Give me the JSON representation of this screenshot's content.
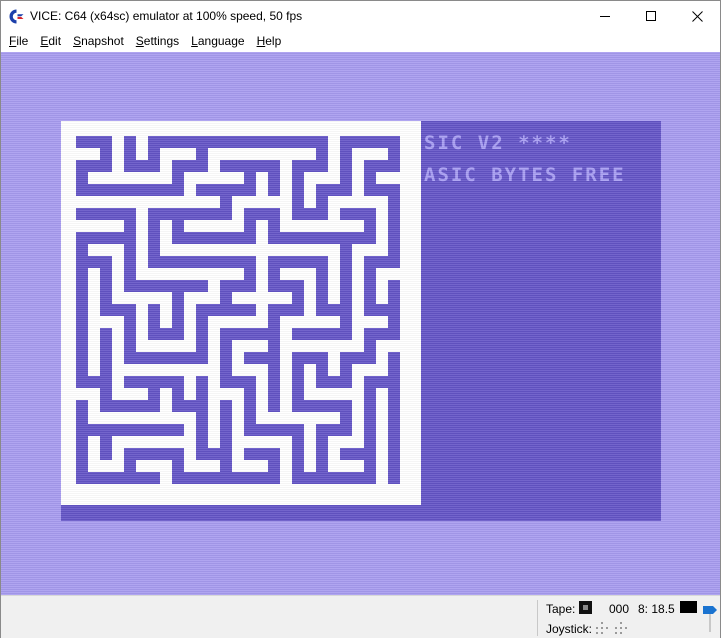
{
  "window": {
    "title": "VICE: C64 (x64sc) emulator at 100% speed, 50 fps",
    "icon": "commodore-logo-icon",
    "controls": [
      "minimize-icon",
      "maximize-icon",
      "close-icon"
    ]
  },
  "menu": [
    {
      "mnemonic": "F",
      "rest": "ile"
    },
    {
      "mnemonic": "E",
      "rest": "dit"
    },
    {
      "mnemonic": "S",
      "rest": "napshot"
    },
    {
      "mnemonic": "S",
      "rest": "ettings"
    },
    {
      "mnemonic": "L",
      "rest": "anguage"
    },
    {
      "mnemonic": "H",
      "rest": "elp"
    }
  ],
  "emulator_screen": {
    "line1": "SIC V2 ****",
    "line2": "ASIC BYTES FREE",
    "colors": {
      "border": "#a79bef",
      "background": "#6354c6",
      "text": "#a89ef2",
      "maze_wall": "#ffffff",
      "maze_path": "#6354c6"
    }
  },
  "statusbar": {
    "tape_label": "Tape:",
    "tape_counter": "000",
    "drive_label": "8: 18.5",
    "joystick_label": "Joystick:",
    "icons": [
      "tape-stop-icon",
      "drive-led-icon",
      "joystick-port-1-icon",
      "joystick-port-2-icon",
      "volume-slider-icon"
    ]
  }
}
